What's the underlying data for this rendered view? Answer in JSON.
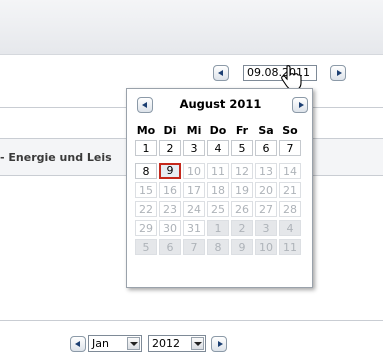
{
  "date_input": {
    "value": "09.08.2011"
  },
  "section": {
    "label": "- Energie und Leis"
  },
  "calendar": {
    "title": "August 2011",
    "weekdays": [
      "Mo",
      "Di",
      "Mi",
      "Do",
      "Fr",
      "Sa",
      "So"
    ],
    "weeks": [
      [
        "1",
        "2",
        "3",
        "4",
        "5",
        "6",
        "7"
      ],
      [
        "8",
        "9",
        "10",
        "11",
        "12",
        "13",
        "14"
      ],
      [
        "15",
        "16",
        "17",
        "18",
        "19",
        "20",
        "21"
      ],
      [
        "22",
        "23",
        "24",
        "25",
        "26",
        "27",
        "28"
      ],
      [
        "29",
        "30",
        "31",
        "1",
        "2",
        "3",
        "4"
      ],
      [
        "5",
        "6",
        "7",
        "8",
        "9",
        "10",
        "11"
      ]
    ],
    "selected_day": "9"
  },
  "bottom": {
    "month": "Jan",
    "year": "2012"
  },
  "icons": {
    "prev": "arrow-left-icon",
    "next": "arrow-right-icon",
    "cursor": "hand-pointer-icon",
    "dropdown": "chevron-down-icon"
  },
  "colors": {
    "selected_border": "#c5281c",
    "nav_arrow": "#1c3f72"
  }
}
